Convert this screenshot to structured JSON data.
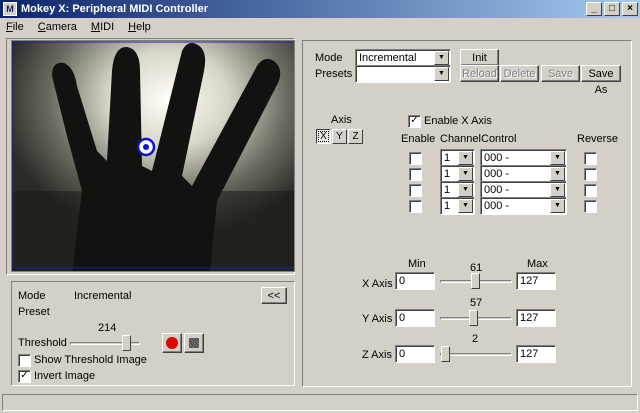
{
  "window": {
    "title": "Mokey X: Peripheral MIDI Controller"
  },
  "menu": [
    "File",
    "Camera",
    "MIDI",
    "Help"
  ],
  "camera_status": {
    "mode_label": "Mode",
    "mode_value": "Incremental",
    "preset_label": "Preset",
    "collapse_label": "<<",
    "threshold_label": "Threshold",
    "threshold_value": "214",
    "threshold_level": 0.84,
    "show_threshold_label": "Show Threshold Image",
    "show_threshold_checked": false,
    "invert_label": "Invert Image",
    "invert_checked": true
  },
  "config": {
    "mode_label": "Mode",
    "mode_value": "Incremental",
    "presets_label": "Presets",
    "presets_value": "",
    "init_label": "Init",
    "reload_label": "Reload",
    "delete_label": "Delete",
    "save_label": "Save",
    "save_as_label": "Save As"
  },
  "axis": {
    "label": "Axis",
    "buttons": [
      "X",
      "Y",
      "Z"
    ],
    "enable_axis_label": "Enable X Axis",
    "enable_axis_checked": true,
    "headers": {
      "enable": "Enable",
      "channel": "Channel",
      "control": "Control",
      "reverse": "Reverse"
    },
    "rows": [
      {
        "channel": "1",
        "control": "000 -"
      },
      {
        "channel": "1",
        "control": "000 -"
      },
      {
        "channel": "1",
        "control": "000 -"
      },
      {
        "channel": "1",
        "control": "000 -"
      }
    ]
  },
  "ranges": {
    "min_label": "Min",
    "max_label": "Max",
    "rows": [
      {
        "label": "X Axis",
        "min": "0",
        "value": "61",
        "level": 0.48,
        "max": "127"
      },
      {
        "label": "Y Axis",
        "min": "0",
        "value": "57",
        "level": 0.45,
        "max": "127"
      },
      {
        "label": "Z Axis",
        "min": "0",
        "value": "2",
        "level": 0.02,
        "max": "127"
      }
    ]
  },
  "colors": {
    "titlebar": "#0a246a",
    "record": "#e00000",
    "tracker": "#1010d0"
  },
  "icons": [
    "app-icon",
    "minimize-icon",
    "maximize-icon",
    "close-icon",
    "record-icon",
    "stop-icon",
    "tracker-icon"
  ]
}
